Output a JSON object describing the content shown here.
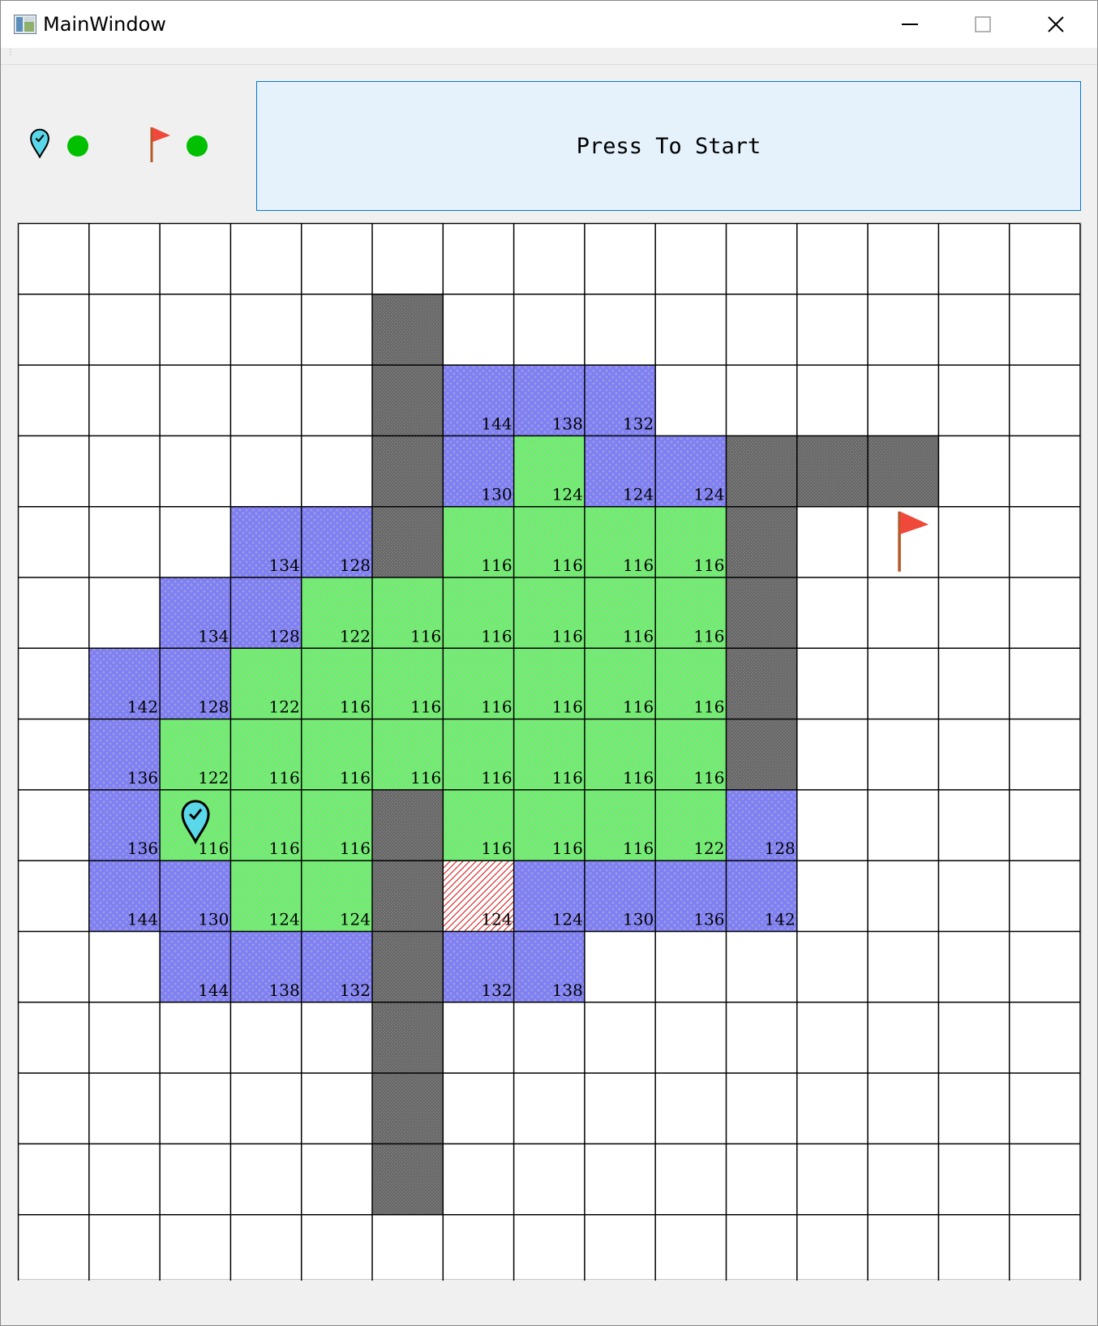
{
  "window": {
    "title": "MainWindow",
    "controls": [
      "minimize-icon",
      "maximize-icon",
      "close-icon"
    ]
  },
  "status": {
    "start_icon": "map-pin-icon",
    "start_status_color": "#00c000",
    "goal_icon": "red-flag-icon",
    "goal_status_color": "#00c000"
  },
  "start_button": {
    "label": "Press To Start"
  },
  "grid": {
    "rows": 15,
    "cols": 15,
    "colors": {
      "open": "#6ef06e",
      "closed": "#7e7ef5",
      "wall": "#6a6a6a",
      "current": "#d83030",
      "empty": "#ffffff",
      "line": "#000000"
    },
    "start": [
      8,
      2
    ],
    "goal": [
      4,
      12
    ],
    "walls": [
      [
        1,
        5
      ],
      [
        2,
        5
      ],
      [
        3,
        5
      ],
      [
        4,
        5
      ],
      [
        3,
        10
      ],
      [
        3,
        11
      ],
      [
        3,
        12
      ],
      [
        4,
        10
      ],
      [
        5,
        10
      ],
      [
        6,
        10
      ],
      [
        7,
        10
      ],
      [
        8,
        5
      ],
      [
        9,
        5
      ],
      [
        10,
        5
      ],
      [
        11,
        5
      ],
      [
        12,
        5
      ],
      [
        13,
        5
      ]
    ],
    "cells": [
      {
        "r": 2,
        "c": 6,
        "s": "closed",
        "v": "144"
      },
      {
        "r": 2,
        "c": 7,
        "s": "closed",
        "v": "138"
      },
      {
        "r": 2,
        "c": 8,
        "s": "closed",
        "v": "132"
      },
      {
        "r": 3,
        "c": 6,
        "s": "closed",
        "v": "130"
      },
      {
        "r": 3,
        "c": 7,
        "s": "open",
        "v": "124"
      },
      {
        "r": 3,
        "c": 8,
        "s": "closed",
        "v": "124"
      },
      {
        "r": 3,
        "c": 9,
        "s": "closed",
        "v": "124"
      },
      {
        "r": 4,
        "c": 3,
        "s": "closed",
        "v": "134"
      },
      {
        "r": 4,
        "c": 4,
        "s": "closed",
        "v": "128"
      },
      {
        "r": 4,
        "c": 6,
        "s": "open",
        "v": "116"
      },
      {
        "r": 4,
        "c": 7,
        "s": "open",
        "v": "116"
      },
      {
        "r": 4,
        "c": 8,
        "s": "open",
        "v": "116"
      },
      {
        "r": 4,
        "c": 9,
        "s": "open",
        "v": "116"
      },
      {
        "r": 5,
        "c": 2,
        "s": "closed",
        "v": "134"
      },
      {
        "r": 5,
        "c": 3,
        "s": "closed",
        "v": "128"
      },
      {
        "r": 5,
        "c": 4,
        "s": "open",
        "v": "122"
      },
      {
        "r": 5,
        "c": 5,
        "s": "open",
        "v": "116"
      },
      {
        "r": 5,
        "c": 6,
        "s": "open",
        "v": "116"
      },
      {
        "r": 5,
        "c": 7,
        "s": "open",
        "v": "116"
      },
      {
        "r": 5,
        "c": 8,
        "s": "open",
        "v": "116"
      },
      {
        "r": 5,
        "c": 9,
        "s": "open",
        "v": "116"
      },
      {
        "r": 6,
        "c": 1,
        "s": "closed",
        "v": "142"
      },
      {
        "r": 6,
        "c": 2,
        "s": "closed",
        "v": "128"
      },
      {
        "r": 6,
        "c": 3,
        "s": "open",
        "v": "122"
      },
      {
        "r": 6,
        "c": 4,
        "s": "open",
        "v": "116"
      },
      {
        "r": 6,
        "c": 5,
        "s": "open",
        "v": "116"
      },
      {
        "r": 6,
        "c": 6,
        "s": "open",
        "v": "116"
      },
      {
        "r": 6,
        "c": 7,
        "s": "open",
        "v": "116"
      },
      {
        "r": 6,
        "c": 8,
        "s": "open",
        "v": "116"
      },
      {
        "r": 6,
        "c": 9,
        "s": "open",
        "v": "116"
      },
      {
        "r": 7,
        "c": 1,
        "s": "closed",
        "v": "136"
      },
      {
        "r": 7,
        "c": 2,
        "s": "open",
        "v": "122"
      },
      {
        "r": 7,
        "c": 3,
        "s": "open",
        "v": "116"
      },
      {
        "r": 7,
        "c": 4,
        "s": "open",
        "v": "116"
      },
      {
        "r": 7,
        "c": 5,
        "s": "open",
        "v": "116"
      },
      {
        "r": 7,
        "c": 6,
        "s": "open",
        "v": "116"
      },
      {
        "r": 7,
        "c": 7,
        "s": "open",
        "v": "116"
      },
      {
        "r": 7,
        "c": 8,
        "s": "open",
        "v": "116"
      },
      {
        "r": 7,
        "c": 9,
        "s": "open",
        "v": "116"
      },
      {
        "r": 8,
        "c": 1,
        "s": "closed",
        "v": "136"
      },
      {
        "r": 8,
        "c": 2,
        "s": "open",
        "v": "116"
      },
      {
        "r": 8,
        "c": 3,
        "s": "open",
        "v": "116"
      },
      {
        "r": 8,
        "c": 4,
        "s": "open",
        "v": "116"
      },
      {
        "r": 8,
        "c": 6,
        "s": "open",
        "v": "116"
      },
      {
        "r": 8,
        "c": 7,
        "s": "open",
        "v": "116"
      },
      {
        "r": 8,
        "c": 8,
        "s": "open",
        "v": "116"
      },
      {
        "r": 8,
        "c": 9,
        "s": "open",
        "v": "122"
      },
      {
        "r": 8,
        "c": 10,
        "s": "closed",
        "v": "128"
      },
      {
        "r": 9,
        "c": 1,
        "s": "closed",
        "v": "144"
      },
      {
        "r": 9,
        "c": 2,
        "s": "closed",
        "v": "130"
      },
      {
        "r": 9,
        "c": 3,
        "s": "open",
        "v": "124"
      },
      {
        "r": 9,
        "c": 4,
        "s": "open",
        "v": "124"
      },
      {
        "r": 9,
        "c": 6,
        "s": "current",
        "v": "124"
      },
      {
        "r": 9,
        "c": 7,
        "s": "closed",
        "v": "124"
      },
      {
        "r": 9,
        "c": 8,
        "s": "closed",
        "v": "130"
      },
      {
        "r": 9,
        "c": 9,
        "s": "closed",
        "v": "136"
      },
      {
        "r": 9,
        "c": 10,
        "s": "closed",
        "v": "142"
      },
      {
        "r": 10,
        "c": 2,
        "s": "closed",
        "v": "144"
      },
      {
        "r": 10,
        "c": 3,
        "s": "closed",
        "v": "138"
      },
      {
        "r": 10,
        "c": 4,
        "s": "closed",
        "v": "132"
      },
      {
        "r": 10,
        "c": 6,
        "s": "closed",
        "v": "132"
      },
      {
        "r": 10,
        "c": 7,
        "s": "closed",
        "v": "138"
      }
    ]
  }
}
